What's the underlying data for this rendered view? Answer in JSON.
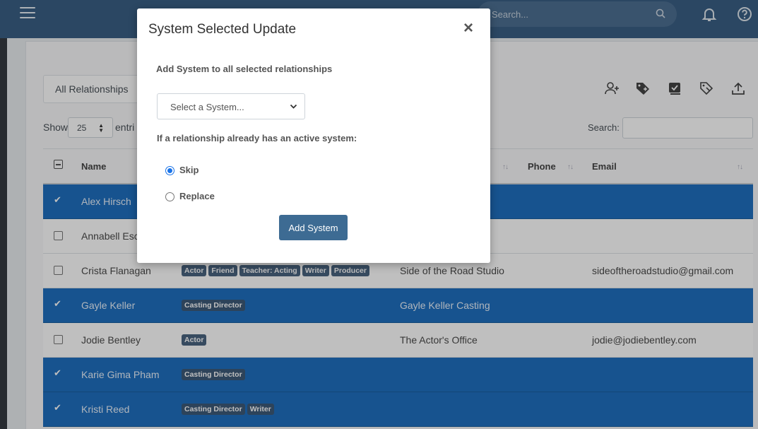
{
  "topbar": {
    "search_placeholder": "Search...",
    "icons": [
      "menu-icon",
      "search-icon",
      "bell-icon",
      "help-icon"
    ]
  },
  "toolbar": {
    "filter_label": "All Relationships",
    "icons": [
      "add-user-icon",
      "tag-plus-icon",
      "checklist-icon",
      "tag-icon",
      "upload-icon"
    ]
  },
  "list_controls": {
    "show_label": "Show",
    "page_size": "25",
    "entries_label": "entri",
    "search_label": "Search:"
  },
  "table": {
    "headers": {
      "name": "Name",
      "phone": "Phone",
      "email": "Email"
    },
    "rows": [
      {
        "selected": true,
        "name": "Alex Hirsch",
        "tags": [],
        "company": "",
        "email": ""
      },
      {
        "selected": false,
        "name": "Annabell Escu",
        "tags": [],
        "company": "",
        "email": ""
      },
      {
        "selected": false,
        "name": "Crista Flanagan",
        "tags": [
          "Actor",
          "Friend",
          "Teacher: Acting",
          "Writer",
          "Producer"
        ],
        "company": "Side of the Road Studio",
        "email": "sideoftheroadstudio@gmail.com"
      },
      {
        "selected": true,
        "name": "Gayle Keller",
        "tags": [
          "Casting Director"
        ],
        "company": "Gayle Keller Casting",
        "email": ""
      },
      {
        "selected": false,
        "name": "Jodie Bentley",
        "tags": [
          "Actor"
        ],
        "company": "The Actor's Office",
        "email": "jodie@jodiebentley.com"
      },
      {
        "selected": true,
        "name": "Karie Gima Pham",
        "tags": [
          "Casting Director"
        ],
        "company": "",
        "email": ""
      },
      {
        "selected": true,
        "name": "Kristi Reed",
        "tags": [
          "Casting Director",
          "Writer"
        ],
        "company": "",
        "email": ""
      }
    ]
  },
  "modal": {
    "title": "System Selected Update",
    "close_symbol": "×",
    "subtitle": "Add System to all selected relationships",
    "select_placeholder": "Select a System...",
    "question": "If a relationship already has an active system:",
    "options": [
      {
        "label": "Skip",
        "checked": true
      },
      {
        "label": "Replace",
        "checked": false
      }
    ],
    "submit_label": "Add System"
  },
  "colors": {
    "topbar": "#3a5f84",
    "selected_row": "#1f6fbf",
    "button": "#3d6b93",
    "tag": "#4a6480"
  }
}
